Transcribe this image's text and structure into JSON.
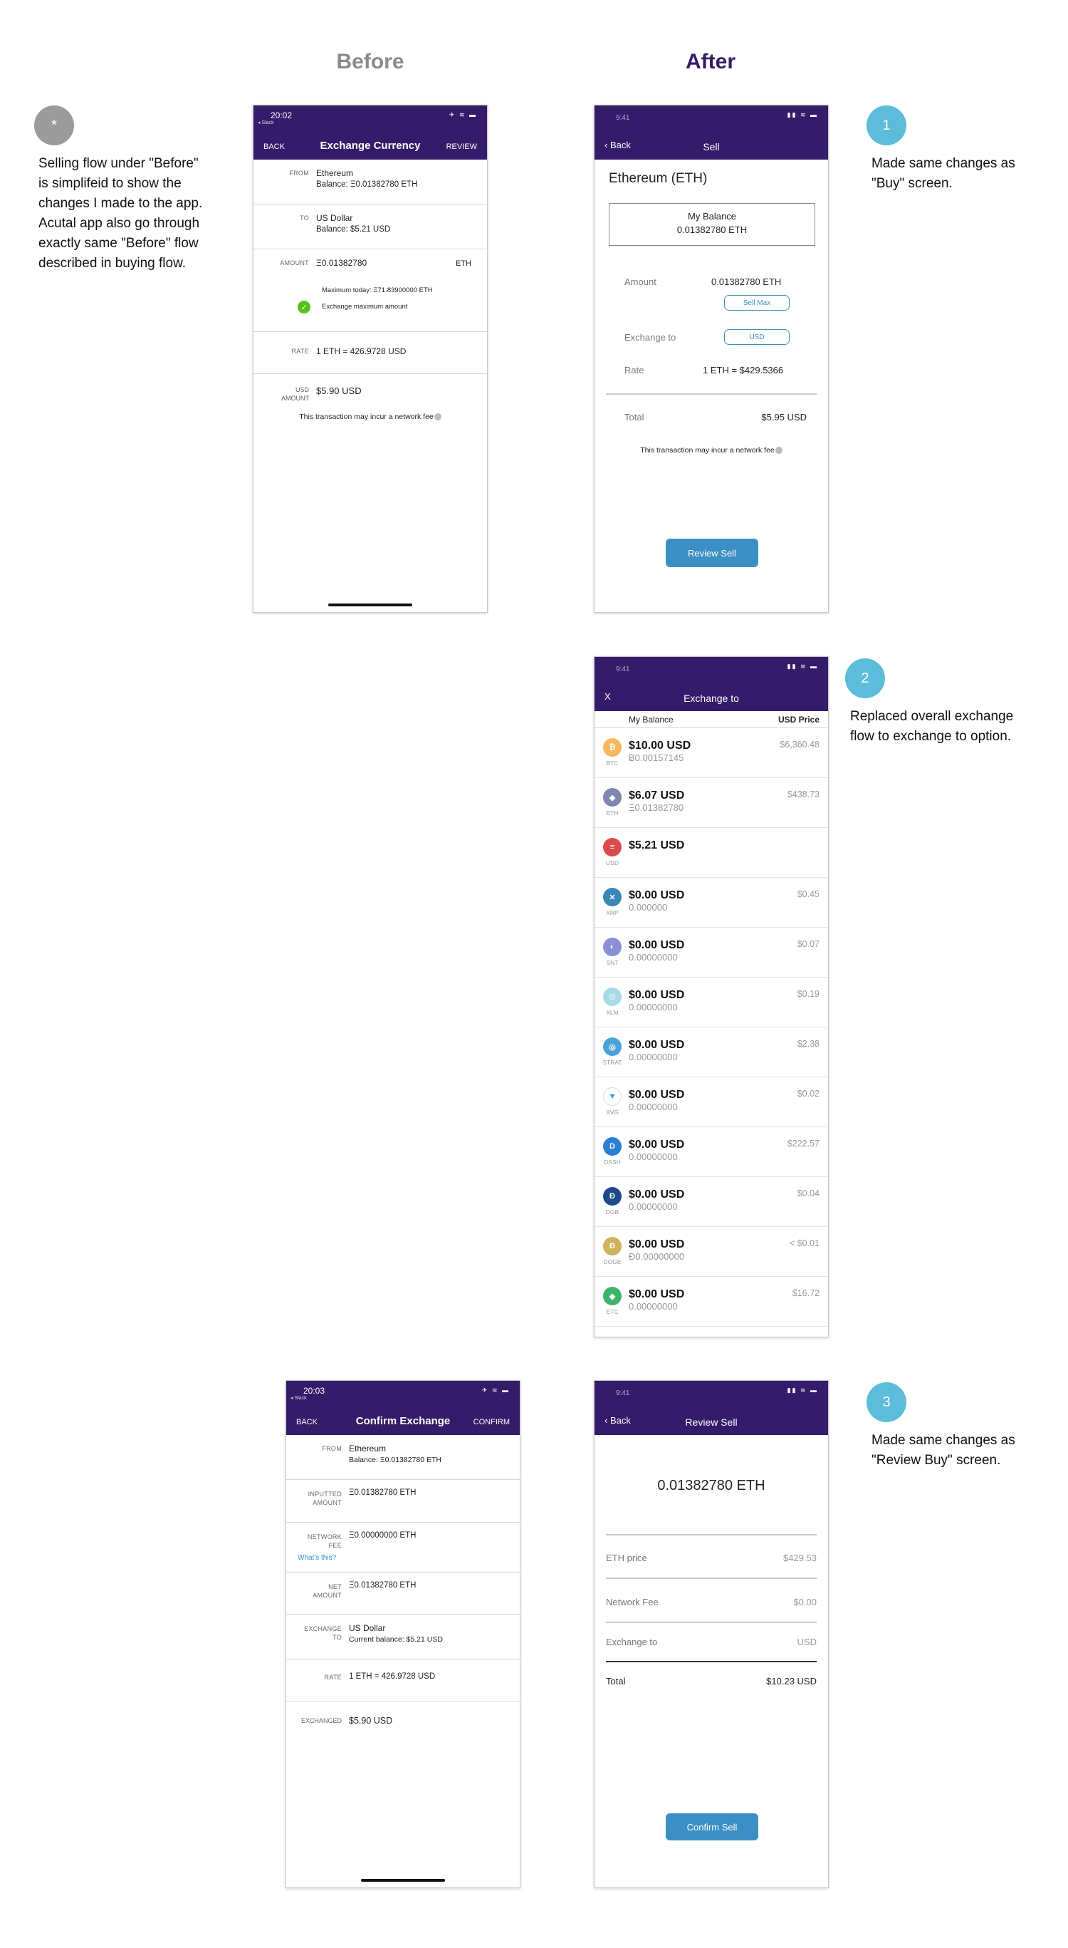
{
  "headings": {
    "before": "Before",
    "after": "After"
  },
  "colors": {
    "before_heading": "#8a8a8a",
    "after_heading": "#341c6a",
    "header_bg": "#341c6a",
    "bubble": "#5cbcd9",
    "bubble_gray": "#9b9b9b",
    "button": "#3b8fc4"
  },
  "notes": {
    "star_bubble": "*",
    "star": [
      "Selling flow under \"Before\"",
      "is simplifeid to show the",
      "changes I made to the app.",
      "Acutal app also go through",
      "exactly same \"Before\" flow",
      "described in buying flow."
    ],
    "n1_bubble": "1",
    "n1": [
      "Made same changes as",
      "\"Buy\" screen."
    ],
    "n2_bubble": "2",
    "n2": [
      "Replaced overall exchange",
      "flow to exchange to option."
    ],
    "n3_bubble": "3",
    "n3": [
      "Made same changes as",
      "\"Review Buy\" screen."
    ]
  },
  "before_exchange": {
    "time": "20:02",
    "status_sub": "◂ Slack",
    "status_icons": "✈ ≋ ▬",
    "back": "BACK",
    "title": "Exchange Currency",
    "review": "REVIEW",
    "from_label": "FROM",
    "from_name": "Ethereum",
    "from_balance": "Balance: Ξ0.01382780 ETH",
    "to_label": "TO",
    "to_name": "US Dollar",
    "to_balance": "Balance: $5.21 USD",
    "amount_label": "AMOUNT",
    "amount_value": "Ξ0.01382780",
    "amount_unit": "ETH",
    "max_today": "Maximum today: Ξ71.83900000 ETH",
    "exchange_max": "Exchange maximum amount",
    "rate_label": "RATE",
    "rate_value": "1 ETH = 426.9728 USD",
    "usd_label_1": "USD",
    "usd_label_2": "AMOUNT",
    "usd_value": "$5.90 USD",
    "fee_note": "This transaction may incur a network fee"
  },
  "after_sell": {
    "time": "9:41",
    "status_icons": "▮▮ ≋ ▬",
    "back": "Back",
    "title": "Sell",
    "coin_title": "Ethereum (ETH)",
    "balance_label": "My Balance",
    "balance_value": "0.01382780 ETH",
    "amount_label": "Amount",
    "amount_value": "0.01382780  ETH",
    "sell_max": "Sell Max",
    "exchange_label": "Exchange to",
    "exchange_value": "USD",
    "rate_label": "Rate",
    "rate_value": "1 ETH = $429.5366",
    "total_label": "Total",
    "total_value": "$5.95 USD",
    "fee_note": "This transaction may incur a network fee",
    "button": "Review Sell"
  },
  "exchange_to": {
    "time": "9:41",
    "status_icons": "▮▮ ≋ ▬",
    "close": "X",
    "title": "Exchange to",
    "col_balance": "My Balance",
    "col_price": "USD Price",
    "rows": [
      {
        "ticker": "BTC",
        "glyph": "₿",
        "color": "#f4b860",
        "usd": "$10.00 USD",
        "bal": "Ƀ0.00157145",
        "price": "$6,360.48"
      },
      {
        "ticker": "ETH",
        "glyph": "◆",
        "color": "#7f86b1",
        "usd": "$6.07 USD",
        "bal": "Ξ0.01382780",
        "price": "$438.73"
      },
      {
        "ticker": "USD",
        "glyph": "≡",
        "color": "#d94a4a",
        "usd": "$5.21 USD",
        "bal": "",
        "price": ""
      },
      {
        "ticker": "XRP",
        "glyph": "✕",
        "color": "#3a86b5",
        "usd": "$0.00 USD",
        "bal": "0.000000",
        "price": "$0.45"
      },
      {
        "ticker": "SNT",
        "glyph": "◐",
        "color": "#8a8fd6",
        "usd": "$0.00 USD",
        "bal": "0.00000000",
        "price": "$0.07"
      },
      {
        "ticker": "XLM",
        "glyph": "☉",
        "color": "#a7dbe6",
        "usd": "$0.00 USD",
        "bal": "0.00000000",
        "price": "$0.19"
      },
      {
        "ticker": "STRAT",
        "glyph": "◎",
        "color": "#4aa3d8",
        "usd": "$0.00 USD",
        "bal": "0.00000000",
        "price": "$2.38"
      },
      {
        "ticker": "XVG",
        "glyph": "▼",
        "color": "#ffffff",
        "usd": "$0.00 USD",
        "bal": "0.00000000",
        "price": "$0.02"
      },
      {
        "ticker": "DASH",
        "glyph": "D",
        "color": "#2b7fd1",
        "usd": "$0.00 USD",
        "bal": "0.00000000",
        "price": "$222.57"
      },
      {
        "ticker": "DGB",
        "glyph": "Đ",
        "color": "#1e4a8c",
        "usd": "$0.00 USD",
        "bal": "0.00000000",
        "price": "$0.04"
      },
      {
        "ticker": "DOGE",
        "glyph": "Ð",
        "color": "#cfb35c",
        "usd": "$0.00 USD",
        "bal": "Ð0.00000000",
        "price": "< $0.01"
      },
      {
        "ticker": "ETC",
        "glyph": "◆",
        "color": "#3eb36a",
        "usd": "$0.00 USD",
        "bal": "0.00000000",
        "price": "$16.72"
      }
    ]
  },
  "before_confirm": {
    "time": "20:03",
    "status_sub": "◂ Slack",
    "status_icons": "✈ ≋ ▬",
    "back": "BACK",
    "title": "Confirm Exchange",
    "confirm": "CONFIRM",
    "from_label": "FROM",
    "from_name": "Ethereum",
    "from_balance": "Balance: Ξ0.01382780 ETH",
    "inputted_label_1": "INPUTTED",
    "inputted_label_2": "AMOUNT",
    "inputted_value": "Ξ0.01382780 ETH",
    "fee_label_1": "NETWORK",
    "fee_label_2": "FEE",
    "fee_value": "Ξ0.00000000 ETH",
    "whats_this": "What's this?",
    "net_label_1": "NET",
    "net_label_2": "AMOUNT",
    "net_value": "Ξ0.01382780 ETH",
    "exch_label_1": "EXCHANGE",
    "exch_label_2": "TO",
    "exch_name": "US Dollar",
    "exch_balance": "Current balance: $5.21 USD",
    "rate_label": "RATE",
    "rate_value": "1 ETH = 426.9728 USD",
    "exchanged_label": "EXCHANGED",
    "exchanged_value": "$5.90 USD"
  },
  "after_review": {
    "time": "9:41",
    "status_icons": "▮▮ ≋ ▬",
    "back": "Back",
    "title": "Review Sell",
    "amount": "0.01382780 ETH",
    "price_label": "ETH price",
    "price_value": "$429.53",
    "fee_label": "Network Fee",
    "fee_value": "$0.00",
    "exch_label": "Exchange to",
    "exch_value": "USD",
    "total_label": "Total",
    "total_value": "$10.23 USD",
    "button": "Confirm Sell"
  }
}
